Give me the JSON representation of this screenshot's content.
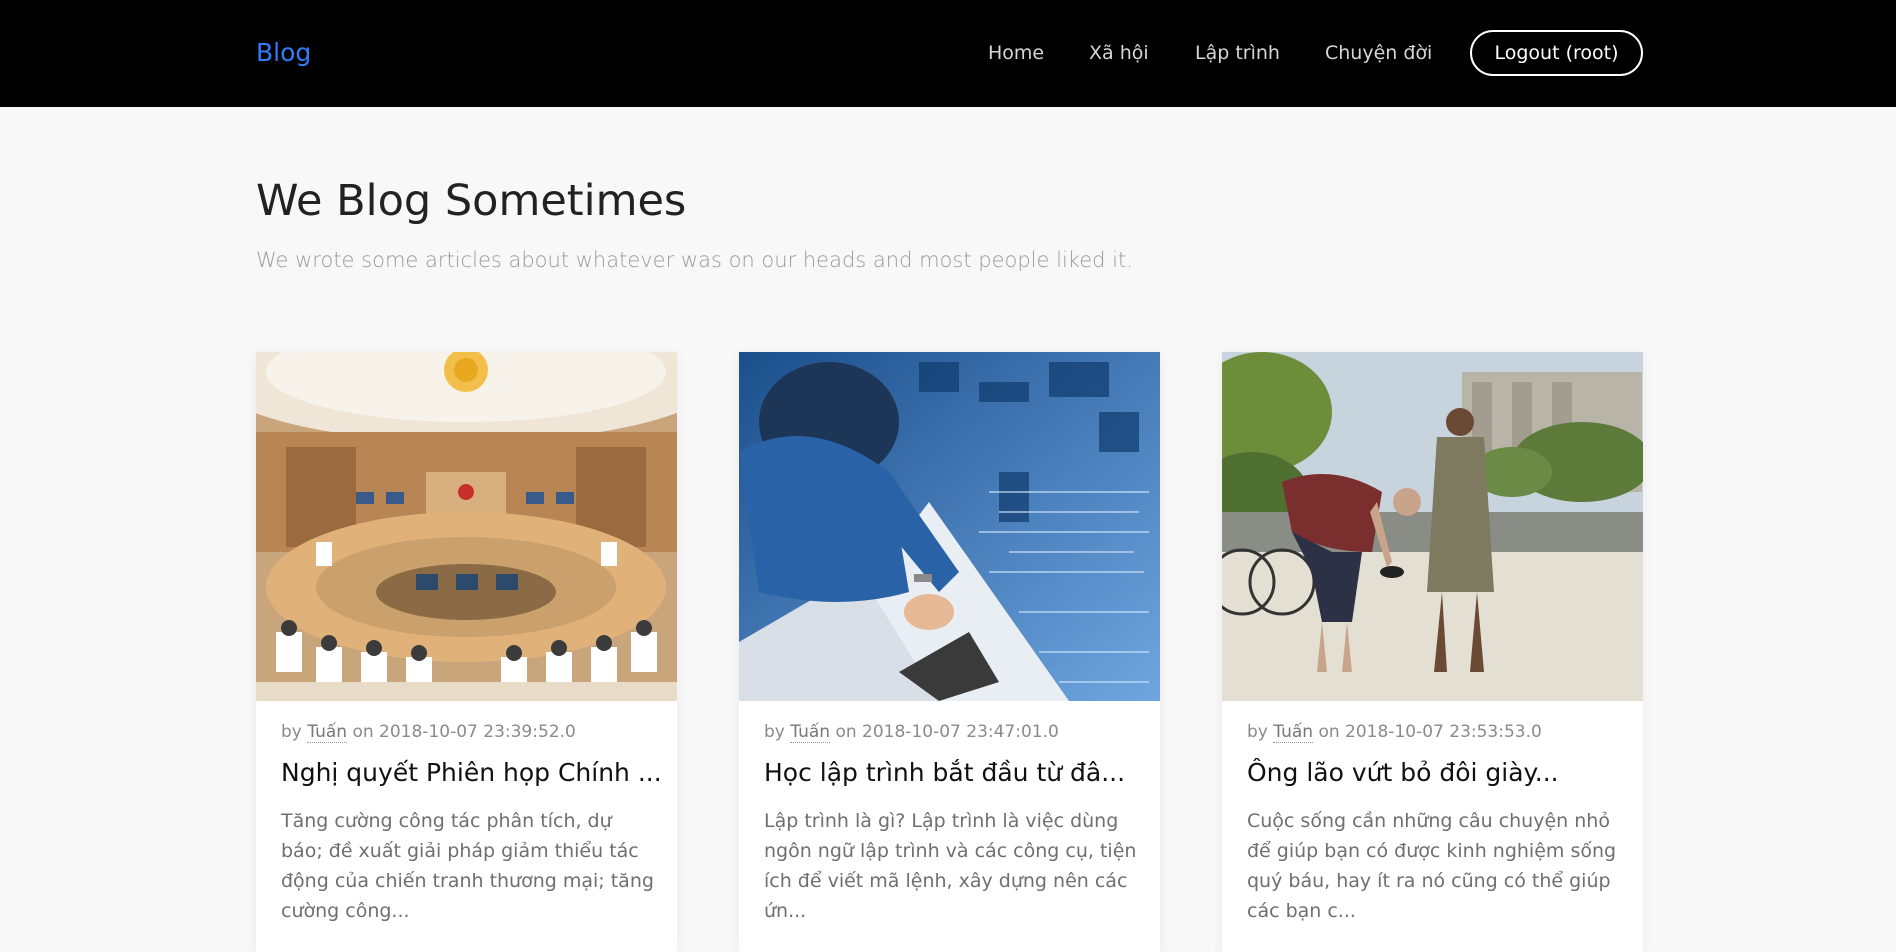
{
  "nav": {
    "brand": "Blog",
    "items": [
      "Home",
      "Xã hội",
      "Lập trình",
      "Chuyện đời"
    ],
    "logout_label": "Logout (root)"
  },
  "header": {
    "title": "We Blog Sometimes",
    "subtitle": "We wrote some articles about whatever was on our heads and most people liked it."
  },
  "posts": [
    {
      "by_label": "by",
      "author": "Tuấn",
      "on_label": "on",
      "date": "2018-10-07 23:39:52.0",
      "title": "Nghị quyết Phiên họp Chính ...",
      "excerpt": "Tăng cường công tác phân tích, dự báo; đề xuất giải pháp giảm thiểu tác động của chiến tranh thương mại; tăng cường công..."
    },
    {
      "by_label": "by",
      "author": "Tuấn",
      "on_label": "on",
      "date": "2018-10-07 23:47:01.0",
      "title": "Học lập trình bắt đầu từ đâ...",
      "excerpt": "Lập trình là gì? Lập trình là việc dùng ngôn ngữ lập trình và các công cụ, tiện ích để viết mã lệnh, xây dựng nên các ứn..."
    },
    {
      "by_label": "by",
      "author": "Tuấn",
      "on_label": "on",
      "date": "2018-10-07 23:53:53.0",
      "title": "Ông lão vứt bỏ đôi giày...",
      "excerpt": "Cuộc sống cần những câu chuyện nhỏ để giúp bạn có được kinh nghiệm sống quý báu, hay ít ra nó cũng có thể giúp các bạn c..."
    }
  ],
  "colors": {
    "navbar_bg": "#000000",
    "brand": "#2f7cf6",
    "page_bg": "#f8f8f8"
  }
}
